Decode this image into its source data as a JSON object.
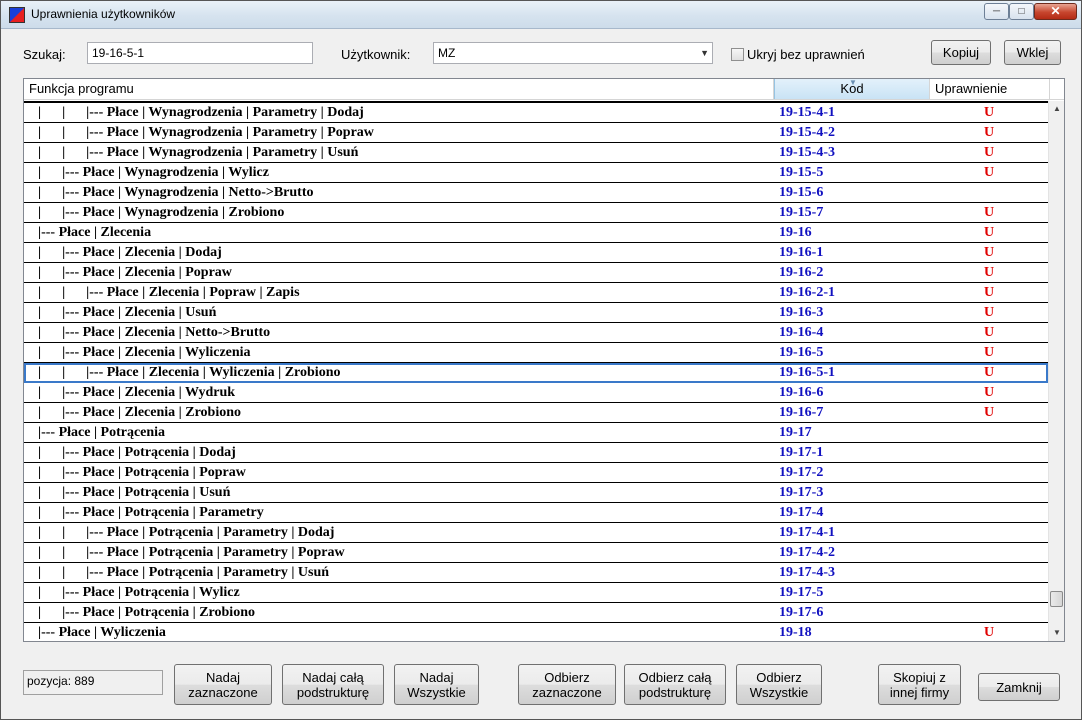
{
  "window": {
    "title": "Uprawnienia użytkowników"
  },
  "search": {
    "label": "Szukaj:",
    "value": "19-16-5-1"
  },
  "user": {
    "label": "Użytkownik:",
    "value": "MZ"
  },
  "hide_checkbox": {
    "label": "Ukryj bez uprawnień",
    "checked": false
  },
  "buttons": {
    "copy": "Kopiuj",
    "paste": "Wklej",
    "grant_selected": "Nadaj\nzaznaczone",
    "grant_substructure": "Nadaj całą\npodstrukturę",
    "grant_all": "Nadaj\nWszystkie",
    "revoke_selected": "Odbierz\nzaznaczone",
    "revoke_substructure": "Odbierz całą\npodstrukturę",
    "revoke_all": "Odbierz\nWszystkie",
    "copy_from_company": "Skopiuj z\ninnej firmy",
    "close": "Zamknij"
  },
  "grid": {
    "columns": {
      "function": "Funkcja programu",
      "code": "Kod",
      "permission": "Uprawnienie"
    },
    "selected_index": 13,
    "rows": [
      {
        "func": "|      |      |--- Płace | Wynagrodzenia | Parametry | Dodaj",
        "code": "19-15-4-1",
        "perm": "U"
      },
      {
        "func": "|      |      |--- Płace | Wynagrodzenia | Parametry | Popraw",
        "code": "19-15-4-2",
        "perm": "U"
      },
      {
        "func": "|      |      |--- Płace | Wynagrodzenia | Parametry | Usuń",
        "code": "19-15-4-3",
        "perm": "U"
      },
      {
        "func": "|      |--- Płace | Wynagrodzenia | Wylicz",
        "code": "19-15-5",
        "perm": "U"
      },
      {
        "func": "|      |--- Płace | Wynagrodzenia | Netto->Brutto",
        "code": "19-15-6",
        "perm": ""
      },
      {
        "func": "|      |--- Płace | Wynagrodzenia | Zrobiono",
        "code": "19-15-7",
        "perm": "U"
      },
      {
        "func": "|--- Płace | Zlecenia",
        "code": "19-16",
        "perm": "U"
      },
      {
        "func": "|      |--- Płace | Zlecenia | Dodaj",
        "code": "19-16-1",
        "perm": "U"
      },
      {
        "func": "|      |--- Płace | Zlecenia | Popraw",
        "code": "19-16-2",
        "perm": "U"
      },
      {
        "func": "|      |      |--- Płace | Zlecenia | Popraw | Zapis",
        "code": "19-16-2-1",
        "perm": "U"
      },
      {
        "func": "|      |--- Płace | Zlecenia | Usuń",
        "code": "19-16-3",
        "perm": "U"
      },
      {
        "func": "|      |--- Płace | Zlecenia | Netto->Brutto",
        "code": "19-16-4",
        "perm": "U"
      },
      {
        "func": "|      |--- Płace | Zlecenia | Wyliczenia",
        "code": "19-16-5",
        "perm": "U"
      },
      {
        "func": "|      |      |--- Płace | Zlecenia | Wyliczenia | Zrobiono",
        "code": "19-16-5-1",
        "perm": "U"
      },
      {
        "func": "|      |--- Płace | Zlecenia | Wydruk",
        "code": "19-16-6",
        "perm": "U"
      },
      {
        "func": "|      |--- Płace | Zlecenia | Zrobiono",
        "code": "19-16-7",
        "perm": "U"
      },
      {
        "func": "|--- Płace | Potrącenia",
        "code": "19-17",
        "perm": ""
      },
      {
        "func": "|      |--- Płace | Potrącenia | Dodaj",
        "code": "19-17-1",
        "perm": ""
      },
      {
        "func": "|      |--- Płace | Potrącenia | Popraw",
        "code": "19-17-2",
        "perm": ""
      },
      {
        "func": "|      |--- Płace | Potrącenia | Usuń",
        "code": "19-17-3",
        "perm": ""
      },
      {
        "func": "|      |--- Płace | Potrącenia | Parametry",
        "code": "19-17-4",
        "perm": ""
      },
      {
        "func": "|      |      |--- Płace | Potrącenia | Parametry | Dodaj",
        "code": "19-17-4-1",
        "perm": ""
      },
      {
        "func": "|      |      |--- Płace | Potrącenia | Parametry | Popraw",
        "code": "19-17-4-2",
        "perm": ""
      },
      {
        "func": "|      |      |--- Płace | Potrącenia | Parametry | Usuń",
        "code": "19-17-4-3",
        "perm": ""
      },
      {
        "func": "|      |--- Płace | Potrącenia | Wylicz",
        "code": "19-17-5",
        "perm": ""
      },
      {
        "func": "|      |--- Płace | Potrącenia | Zrobiono",
        "code": "19-17-6",
        "perm": ""
      },
      {
        "func": "|--- Płace | Wyliczenia",
        "code": "19-18",
        "perm": "U"
      }
    ]
  },
  "status": {
    "label": "pozycja:",
    "value": "889"
  },
  "colors": {
    "code": "#1010c0",
    "permission": "#e00000",
    "selection": "#3a79c9"
  }
}
